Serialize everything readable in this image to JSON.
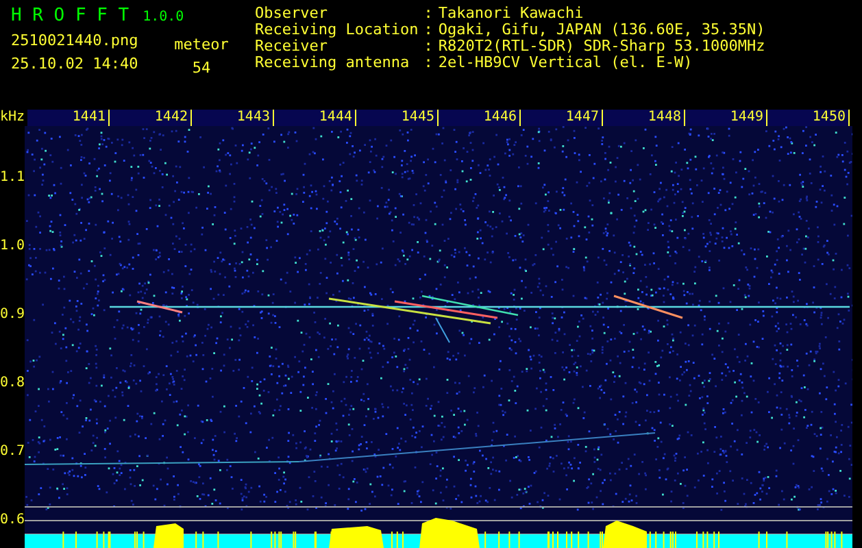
{
  "app": {
    "title": "H R O F F T",
    "version": "1.0.0"
  },
  "capture": {
    "file_name": "2510021440.png",
    "timestamp": "25.10.02 14:40",
    "count_label": "meteor",
    "count": "54"
  },
  "station_info": [
    {
      "label": "Observer",
      "separator": ":",
      "value": "Takanori Kawachi"
    },
    {
      "label": "Receiving Location",
      "separator": ":",
      "value": "Ogaki, Gifu, JAPAN (136.60E, 35.35N)"
    },
    {
      "label": "Receiver",
      "separator": ":",
      "value": "R820T2(RTL-SDR) SDR-Sharp 53.1000MHz"
    },
    {
      "label": "Receiving antenna",
      "separator": ":",
      "value": "2el-HB9CV Vertical (el. E-W)"
    }
  ],
  "frequency_axis": {
    "unit": "kHz",
    "labels": [
      "1441",
      "1442",
      "1443",
      "1444",
      "1445",
      "1446",
      "1447",
      "1448",
      "1449",
      "1450"
    ]
  },
  "time_axis": {
    "labels": [
      "1.1",
      "1.0",
      "0.9",
      "0.8",
      "0.7",
      "0.6"
    ]
  }
}
